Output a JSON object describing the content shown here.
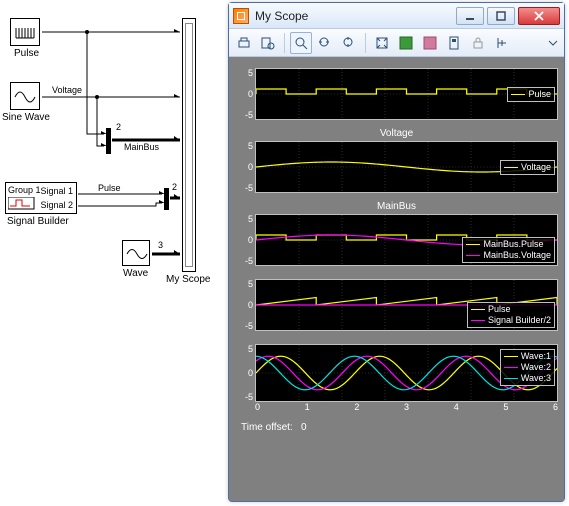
{
  "diagram": {
    "blocks": {
      "pulse": "Pulse",
      "sine": "Sine Wave",
      "sigbuilder": "Signal Builder",
      "sigbuilder_title": "Group 1",
      "sigbuilder_out1": "Signal 1",
      "sigbuilder_out2": "Signal 2",
      "wave": "Wave",
      "scope": "My Scope",
      "mainbus": "MainBus",
      "voltage": "Voltage",
      "pulse_port": "Pulse",
      "two_a": "2",
      "two_b": "2",
      "three": "3"
    }
  },
  "window": {
    "title": "My Scope"
  },
  "footer": {
    "label": "Time offset:",
    "value": "0"
  },
  "yticks": {
    "top": "5",
    "mid": "0",
    "bot": "-5"
  },
  "xticks": [
    "0",
    "1",
    "2",
    "3",
    "4",
    "5",
    "6"
  ],
  "chart_data": [
    {
      "type": "line",
      "title": "",
      "ylim": [
        -5,
        5
      ],
      "x_range": [
        0,
        7
      ],
      "series": [
        {
          "name": "Pulse",
          "color": "#ffff00",
          "shape": "square",
          "period": 1.4,
          "amplitude": 1
        }
      ]
    },
    {
      "type": "line",
      "title": "Voltage",
      "ylim": [
        -5,
        5
      ],
      "x_range": [
        0,
        7
      ],
      "series": [
        {
          "name": "Voltage",
          "color": "#ffff00",
          "shape": "sine",
          "period": 7,
          "amplitude": 1
        }
      ]
    },
    {
      "type": "line",
      "title": "MainBus",
      "ylim": [
        -5,
        5
      ],
      "x_range": [
        0,
        7
      ],
      "series": [
        {
          "name": "MainBus.Pulse",
          "color": "#ffff00",
          "shape": "square",
          "period": 1.4,
          "amplitude": 1
        },
        {
          "name": "MainBus.Voltage",
          "color": "#ff00ff",
          "shape": "sine",
          "period": 7,
          "amplitude": 1
        }
      ]
    },
    {
      "type": "line",
      "title": "",
      "ylim": [
        -5,
        5
      ],
      "x_range": [
        0,
        7
      ],
      "series": [
        {
          "name": "Pulse",
          "color": "#ffff00",
          "shape": "sawtooth",
          "period": 1.4,
          "amplitude": 1.5
        },
        {
          "name": "Signal Builder/2",
          "color": "#ff00ff",
          "shape": "flat",
          "value": 0
        }
      ]
    },
    {
      "type": "line",
      "title": "",
      "ylim": [
        -5,
        5
      ],
      "x_range": [
        0,
        7
      ],
      "series": [
        {
          "name": "Wave:1",
          "color": "#ffff00",
          "shape": "sine",
          "period": 2.3,
          "amplitude": 3,
          "phase": 0
        },
        {
          "name": "Wave:2",
          "color": "#ff00ff",
          "shape": "sine",
          "period": 2.3,
          "amplitude": 3,
          "phase": 0.8
        },
        {
          "name": "Wave:3",
          "color": "#00e0e0",
          "shape": "sine",
          "period": 2.3,
          "amplitude": 3,
          "phase": 1.6
        }
      ]
    }
  ]
}
